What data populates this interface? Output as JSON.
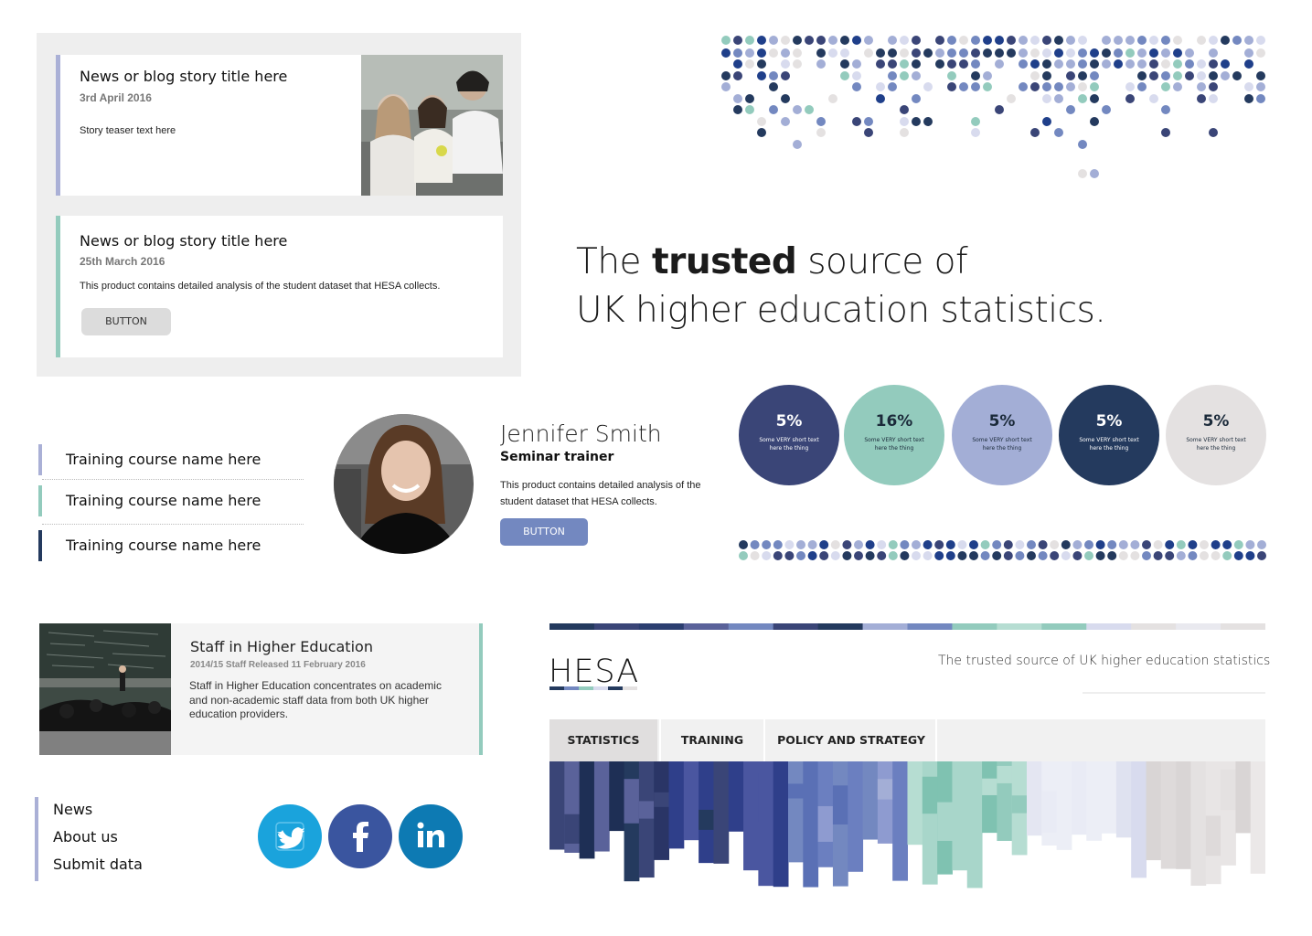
{
  "news": {
    "card1": {
      "title": "News or blog story title here",
      "date": "3rd April 2016",
      "teaser": "Story teaser text here"
    },
    "card2": {
      "title": "News or blog story title here",
      "date": "25th March 2016",
      "teaser": "This product contains detailed analysis of the student dataset that HESA collects.",
      "button": "BUTTON"
    }
  },
  "headline": {
    "pre": "The ",
    "bold": "trusted",
    "post": " source of",
    "line2": "UK higher education statistics."
  },
  "training": [
    "Training course name here",
    "Training course name here",
    "Training course name here"
  ],
  "person": {
    "name": "Jennifer Smith",
    "role": "Seminar trainer",
    "description": "This product contains detailed analysis of the student dataset that HESA collects.",
    "button": "BUTTON"
  },
  "stats": [
    {
      "value": "5%",
      "label": "Some VERY short text here the thing",
      "bg": "#3a4577",
      "fg": "#ffffff"
    },
    {
      "value": "16%",
      "label": "Some VERY short text here the thing",
      "bg": "#93cbbd",
      "fg": "#1b2a3a"
    },
    {
      "value": "5%",
      "label": "Some VERY short text here the thing",
      "bg": "#a3aed6",
      "fg": "#1b2a3a"
    },
    {
      "value": "5%",
      "label": "Some VERY short text here the thing",
      "bg": "#243a5e",
      "fg": "#ffffff"
    },
    {
      "value": "5%",
      "label": "Some VERY short text here the thing",
      "bg": "#e4e1e1",
      "fg": "#1b2a3a"
    }
  ],
  "publication": {
    "title": "Staff in Higher Education",
    "date": "2014/15 Staff Released 11 February 2016",
    "description": "Staff in Higher Education concentrates on academic and non-academic staff data from both UK higher education providers."
  },
  "footer_nav": [
    "News",
    "About us",
    "Submit data"
  ],
  "social": [
    {
      "name": "twitter-icon",
      "color": "#1aa3dc"
    },
    {
      "name": "facebook-icon",
      "color": "#3a559f"
    },
    {
      "name": "linkedin-icon",
      "color": "#0d7ab3"
    }
  ],
  "header": {
    "logo": "HESA",
    "tagline": "The trusted source of  UK higher education statistics"
  },
  "nav_tabs": [
    "STATISTICS",
    "TRAINING",
    "POLICY AND STRATEGY"
  ],
  "colors": {
    "navy": "#243a5e",
    "indigo": "#3a4577",
    "lavender": "#a3aed6",
    "mint": "#93cbbd",
    "grey": "#e4e1e1",
    "blue": "#7388c0"
  }
}
